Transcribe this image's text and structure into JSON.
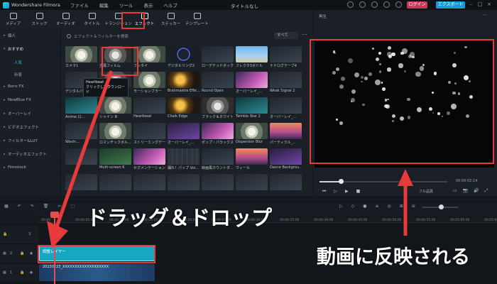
{
  "app": {
    "name": "Wondershare Filmora",
    "doc_title": "タイトルなし"
  },
  "menu": [
    "ファイル",
    "編集",
    "ツール",
    "表示",
    "ヘルプ"
  ],
  "header": {
    "login_label": "ログイン",
    "export_label": "エクスポート",
    "window_controls": [
      "–",
      "□",
      "×"
    ]
  },
  "toolbar": {
    "items": [
      {
        "label": "メディア",
        "icon": "media-icon"
      },
      {
        "label": "ストック",
        "icon": "stock-icon"
      },
      {
        "label": "オーディオ",
        "icon": "music-icon"
      },
      {
        "label": "タイトル",
        "icon": "title-icon"
      },
      {
        "label": "トランジション",
        "icon": "transition-icon"
      },
      {
        "label": "エフェクト",
        "icon": "effects-icon",
        "active": true
      },
      {
        "label": "ステッカー",
        "icon": "sticker-icon"
      },
      {
        "label": "テンプレート",
        "icon": "template-icon"
      }
    ]
  },
  "sidebar": {
    "items": [
      {
        "label": "個人"
      },
      {
        "label": "おすすめ",
        "open": true,
        "children": [
          "人気",
          "新着"
        ]
      },
      {
        "label": "Boris FX"
      },
      {
        "label": "NewBlue FX"
      },
      {
        "label": "オーバーレイ"
      },
      {
        "label": "ビデオエフェクト"
      },
      {
        "label": "フィルター&LUT"
      },
      {
        "label": "オーディオエフェクト"
      },
      {
        "label": "Filmstock"
      }
    ]
  },
  "library": {
    "search_placeholder": "エフェクト＆フィルターを検索",
    "filter_label": "すべて",
    "tooltip_line1": "Heartbeat",
    "tooltip_line2": "クリックしてダウンロード",
    "effects": [
      {
        "name": "カメラ1",
        "style": "t-flower"
      },
      {
        "name": "古風フィルム",
        "style": "t-bw"
      },
      {
        "name": "フンタイ",
        "style": "t-flower"
      },
      {
        "name": "デジタルリング2",
        "style": "t-ring"
      },
      {
        "name": "ローデテッドボックス",
        "style": "t-dark"
      },
      {
        "name": "フレクタ3ボドル",
        "style": "t-sky"
      },
      {
        "name": "ナナログテーブ4",
        "style": "t-dark"
      },
      {
        "name": "デジタルパーク",
        "style": "t-dark"
      },
      {
        "name": "グリッチラインズ",
        "style": "t-bw"
      },
      {
        "name": "モーションブラー",
        "style": "t-flower"
      },
      {
        "name": "Brahmastra Effe...",
        "style": "t-gold"
      },
      {
        "name": "Round Open",
        "style": "t-dark"
      },
      {
        "name": "オーバーレイ_...",
        "style": "t-pink"
      },
      {
        "name": "Weak Signal 2",
        "style": "t-dark"
      },
      {
        "name": "Anime ロ...",
        "style": "t-teal"
      },
      {
        "name": "シャイン B",
        "style": "t-flower"
      },
      {
        "name": "Heartbeat",
        "style": "t-dark"
      },
      {
        "name": "Chalk Edge",
        "style": "t-gold"
      },
      {
        "name": "ブラック＆ホワイト...",
        "style": "t-bw"
      },
      {
        "name": "Twinkle Star 2",
        "style": "t-teal"
      },
      {
        "name": "オーバーレイ_...",
        "style": "t-dark"
      },
      {
        "name": "Wavin...",
        "style": "t-dark"
      },
      {
        "name": "ロマンチックボル...",
        "style": "t-flower"
      },
      {
        "name": "ストリーミングデー...",
        "style": "t-dark"
      },
      {
        "name": "オーバーレイ_...",
        "style": "t-purple"
      },
      {
        "name": "ポップ・パラックス",
        "style": "t-pink"
      },
      {
        "name": "Dispersion Blur",
        "style": "t-flower"
      },
      {
        "name": "パーティクル_...",
        "style": "t-sunset"
      },
      {
        "name": "",
        "style": "t-dark"
      },
      {
        "name": "Multi-screen 6",
        "style": "t-green"
      },
      {
        "name": "セグメンテーション",
        "style": "t-pink"
      },
      {
        "name": "踊れ！パップ Vol...",
        "style": "t-grid"
      },
      {
        "name": "映画風カウントダ...",
        "style": "t-dark"
      },
      {
        "name": "ウィール",
        "style": "t-sunset"
      },
      {
        "name": "Dance Backgrou...",
        "style": "t-purple"
      },
      {
        "name": "",
        "style": "t-dark"
      },
      {
        "name": "",
        "style": "t-dark"
      },
      {
        "name": "",
        "style": "t-dark"
      },
      {
        "name": "",
        "style": "t-dark"
      },
      {
        "name": "",
        "style": "t-dark"
      },
      {
        "name": "",
        "style": "t-dark"
      },
      {
        "name": "",
        "style": "t-dark"
      }
    ]
  },
  "player": {
    "title": "再生",
    "current_time": "00:00:02:14",
    "quality_label": "フル品質",
    "transport": [
      "⏮",
      "▷",
      "▶",
      "■"
    ],
    "icons": [
      "▭",
      "📷",
      "🔊",
      "⤢"
    ]
  },
  "timeline": {
    "ruler": [
      "00:00",
      "00:00:05:00",
      "00:00:10:00",
      "00:00:15:00",
      "00:00:20:00",
      "00:00:25:00",
      "00:00:30:00",
      "00:00:35:00",
      "00:00:40:00",
      "00:00:45:00",
      "00:00:50:00",
      "00:00:55:00",
      "00:01:00:00",
      "00:01:05:00"
    ],
    "tracks": [
      {
        "label": "3",
        "icon": "lock-icon"
      },
      {
        "label": "2",
        "icon": "effect-track-icon"
      },
      {
        "label": "1",
        "icon": "video-track-icon"
      }
    ],
    "adjust_clip_label": "調整レイヤー",
    "video_clip_label": "20230223_XXXXXXXXXXXXXXXXXXX"
  },
  "annotations": {
    "drag_text": "ドラッグ＆ドロップ",
    "result_text": "動画に反映される",
    "color": "#e83a3a"
  }
}
